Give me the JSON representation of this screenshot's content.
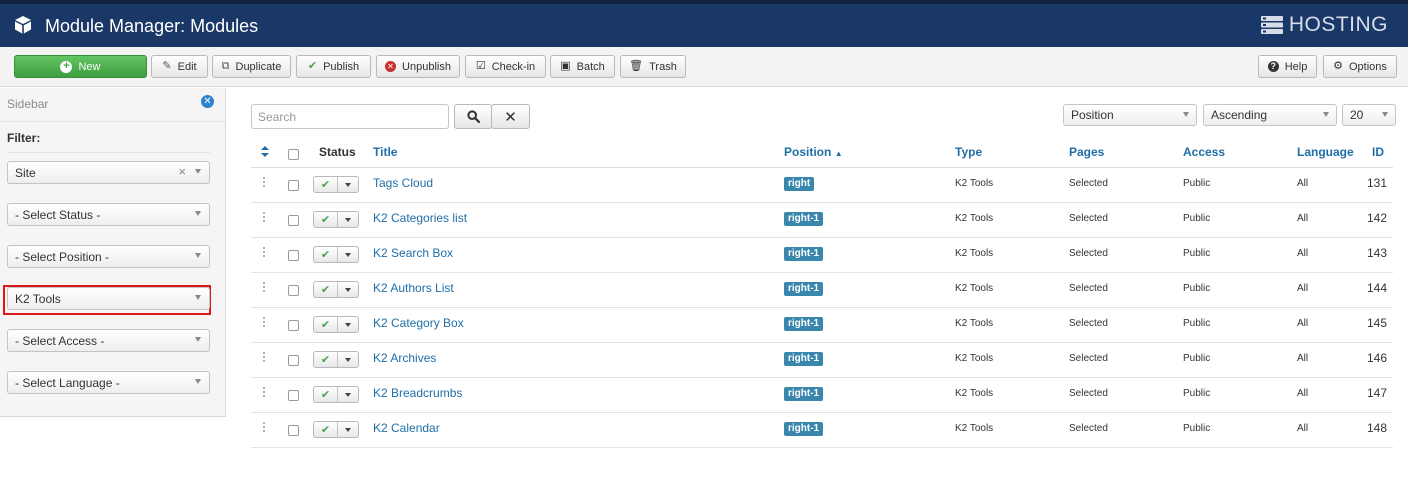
{
  "header": {
    "title": "Module Manager: Modules",
    "brand": "HOSTING"
  },
  "toolbar": {
    "new": "New",
    "edit": "Edit",
    "duplicate": "Duplicate",
    "publish": "Publish",
    "unpublish": "Unpublish",
    "checkin": "Check-in",
    "batch": "Batch",
    "trash": "Trash",
    "help": "Help",
    "options": "Options"
  },
  "sidebar": {
    "title": "Sidebar",
    "filter_label": "Filter:",
    "filters": {
      "site": "Site",
      "status": "- Select Status -",
      "position": "- Select Position -",
      "type": "K2 Tools",
      "access": "- Select Access -",
      "language": "- Select Language -"
    }
  },
  "search": {
    "placeholder": "Search"
  },
  "list_controls": {
    "order_by": "Position",
    "direction": "Ascending",
    "limit": "20"
  },
  "table": {
    "headers": {
      "status": "Status",
      "title": "Title",
      "position": "Position",
      "type": "Type",
      "pages": "Pages",
      "access": "Access",
      "language": "Language",
      "id": "ID"
    },
    "rows": [
      {
        "title": "Tags Cloud",
        "position": "right",
        "type": "K2 Tools",
        "pages": "Selected",
        "access": "Public",
        "language": "All",
        "id": "131"
      },
      {
        "title": "K2 Categories list",
        "position": "right-1",
        "type": "K2 Tools",
        "pages": "Selected",
        "access": "Public",
        "language": "All",
        "id": "142"
      },
      {
        "title": "K2 Search Box",
        "position": "right-1",
        "type": "K2 Tools",
        "pages": "Selected",
        "access": "Public",
        "language": "All",
        "id": "143"
      },
      {
        "title": "K2 Authors List",
        "position": "right-1",
        "type": "K2 Tools",
        "pages": "Selected",
        "access": "Public",
        "language": "All",
        "id": "144"
      },
      {
        "title": "K2 Category Box",
        "position": "right-1",
        "type": "K2 Tools",
        "pages": "Selected",
        "access": "Public",
        "language": "All",
        "id": "145"
      },
      {
        "title": "K2 Archives",
        "position": "right-1",
        "type": "K2 Tools",
        "pages": "Selected",
        "access": "Public",
        "language": "All",
        "id": "146"
      },
      {
        "title": "K2 Breadcrumbs",
        "position": "right-1",
        "type": "K2 Tools",
        "pages": "Selected",
        "access": "Public",
        "language": "All",
        "id": "147"
      },
      {
        "title": "K2 Calendar",
        "position": "right-1",
        "type": "K2 Tools",
        "pages": "Selected",
        "access": "Public",
        "language": "All",
        "id": "148"
      }
    ]
  },
  "colors": {
    "header_bg": "#1a3867",
    "accent": "#1f6ea8",
    "badge": "#3a87ad",
    "new_button": "#47a447",
    "highlight": "#e1161b"
  }
}
